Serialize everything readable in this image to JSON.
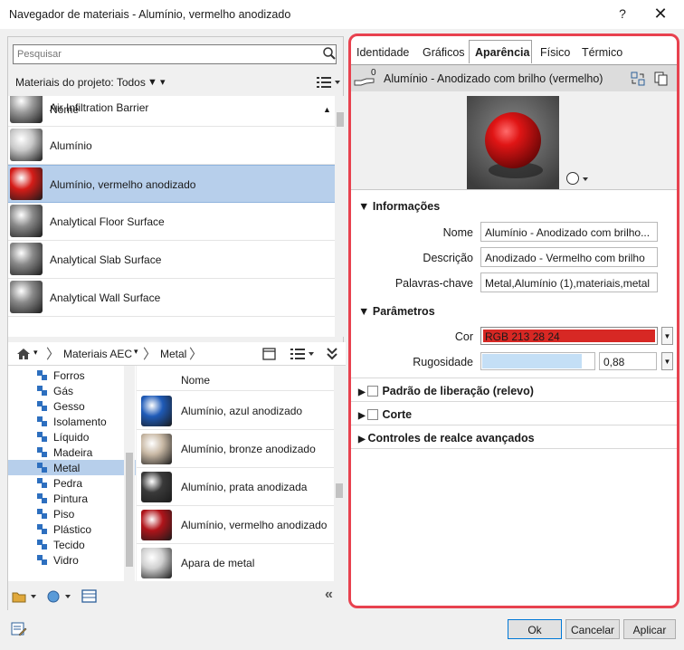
{
  "window": {
    "title": "Navegador de materiais - Alumínio, vermelho anodizado",
    "help": "?",
    "close": "✕"
  },
  "left": {
    "search_placeholder": "Pesquisar",
    "project_filter_label": "Materiais do projeto: Todos",
    "project_list_header": "Nome",
    "project_materials": [
      {
        "name": "Air Infiltration Barrier",
        "color": "#9a9a9a"
      },
      {
        "name": "Alumínio",
        "color": "#c8c8c8"
      },
      {
        "name": "Alumínio, vermelho anodizado",
        "color": "#d51c18",
        "selected": true
      },
      {
        "name": "Analytical Floor Surface",
        "color": "#8a8a8a"
      },
      {
        "name": "Analytical Slab Surface",
        "color": "#8a8a8a"
      },
      {
        "name": "Analytical Wall Surface",
        "color": "#8a8a8a"
      }
    ],
    "breadcrumb": [
      "Materiais AEC",
      "Metal"
    ],
    "tree_items": [
      {
        "label": "Forros"
      },
      {
        "label": "Gás"
      },
      {
        "label": "Gesso"
      },
      {
        "label": "Isolamento"
      },
      {
        "label": "Líquido"
      },
      {
        "label": "Madeira"
      },
      {
        "label": "Metal",
        "selected": true
      },
      {
        "label": "Pedra"
      },
      {
        "label": "Pintura"
      },
      {
        "label": "Piso"
      },
      {
        "label": "Plástico"
      },
      {
        "label": "Tecido"
      },
      {
        "label": "Vidro"
      }
    ],
    "library_list_header": "Nome",
    "library_materials": [
      {
        "name": "Alumínio, azul anodizado",
        "color": "#1f5bb8"
      },
      {
        "name": "Alumínio, bronze anodizado",
        "color": "#c9b9a5"
      },
      {
        "name": "Alumínio, prata anodizada",
        "color": "#3a3a3a"
      },
      {
        "name": "Alumínio, vermelho anodizado",
        "color": "#b0141a"
      },
      {
        "name": "Apara de metal",
        "color": "#d0d0d0"
      }
    ]
  },
  "right": {
    "tabs": [
      "Identidade",
      "Gráficos",
      "Aparência",
      "Físico",
      "Térmico"
    ],
    "active_tab": "Aparência",
    "asset_count": "0",
    "asset_name": "Alumínio - Anodizado com brilho (vermelho)",
    "sections": {
      "info": "Informações",
      "params": "Parâmetros",
      "relief": "Padrão de liberação (relevo)",
      "cut": "Corte",
      "advanced": "Controles de realce avançados"
    },
    "fields": {
      "name_label": "Nome",
      "name_value": "Alumínio - Anodizado com brilho...",
      "desc_label": "Descrição",
      "desc_value": "Anodizado - Vermelho com brilho",
      "keywords_label": "Palavras-chave",
      "keywords_value": "Metal,Alumínio (1),materiais,metal",
      "color_label": "Cor",
      "color_value": "RGB 213 28 24",
      "roughness_label": "Rugosidade",
      "roughness_value": "0,88"
    },
    "color_swatch": "#d51c18",
    "roughness_fraction": 0.88
  },
  "footer": {
    "ok": "Ok",
    "cancel": "Cancelar",
    "apply": "Aplicar"
  }
}
